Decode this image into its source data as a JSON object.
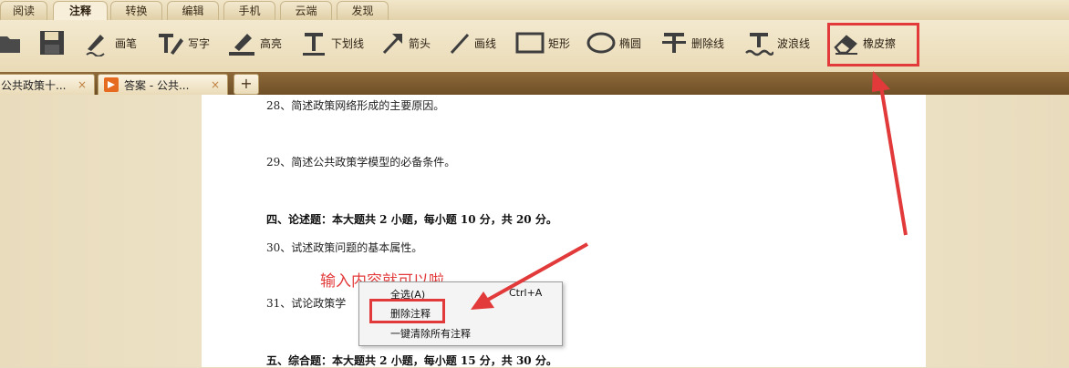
{
  "menu": {
    "tabs": [
      "阅读",
      "注释",
      "转换",
      "编辑",
      "手机",
      "云端",
      "发现"
    ],
    "active_index": 1
  },
  "toolbar": {
    "tools": [
      {
        "name": "folder",
        "label": ""
      },
      {
        "name": "save",
        "label": ""
      },
      {
        "name": "pen",
        "label": "画笔"
      },
      {
        "name": "write",
        "label": "写字"
      },
      {
        "name": "highlight",
        "label": "高亮"
      },
      {
        "name": "underline",
        "label": "下划线"
      },
      {
        "name": "arrow",
        "label": "箭头"
      },
      {
        "name": "line",
        "label": "画线"
      },
      {
        "name": "rectangle",
        "label": "矩形"
      },
      {
        "name": "ellipse",
        "label": "椭圆"
      },
      {
        "name": "strikethrough",
        "label": "删除线"
      },
      {
        "name": "wavy",
        "label": "波浪线"
      },
      {
        "name": "eraser",
        "label": "橡皮擦"
      }
    ]
  },
  "tabs": [
    {
      "title": "公共政策十...",
      "close": "×"
    },
    {
      "title": "答案 - 公共...",
      "close": "×"
    }
  ],
  "new_tab_label": "+",
  "document": {
    "lines": [
      {
        "text": "28、简述政策网络形成的主要原因。",
        "bold": false
      },
      {
        "text": "29、简述公共政策学模型的必备条件。",
        "bold": false
      },
      {
        "text": "四、论述题：本大题共 2 小题，每小题 10 分，共 20 分。",
        "bold": true
      },
      {
        "text": "30、试述政策问题的基本属性。",
        "bold": false
      },
      {
        "text": "31、试论政策学",
        "bold": false
      },
      {
        "text": "五、综合题：本大题共 2 小题，每小题 15 分，共 30 分。",
        "bold": true
      }
    ],
    "annotation_text": "输入内容就可以啦"
  },
  "context_menu": {
    "items": [
      {
        "label": "全选(A)",
        "shortcut": "Ctrl+A"
      },
      {
        "label": "删除注释",
        "shortcut": ""
      },
      {
        "label": "一键清除所有注释",
        "shortcut": ""
      }
    ]
  },
  "colors": {
    "highlight_red": "#e23a3a",
    "toolbar_bg": "#eadbb7",
    "tabstrip_bg": "#7a5a30"
  }
}
